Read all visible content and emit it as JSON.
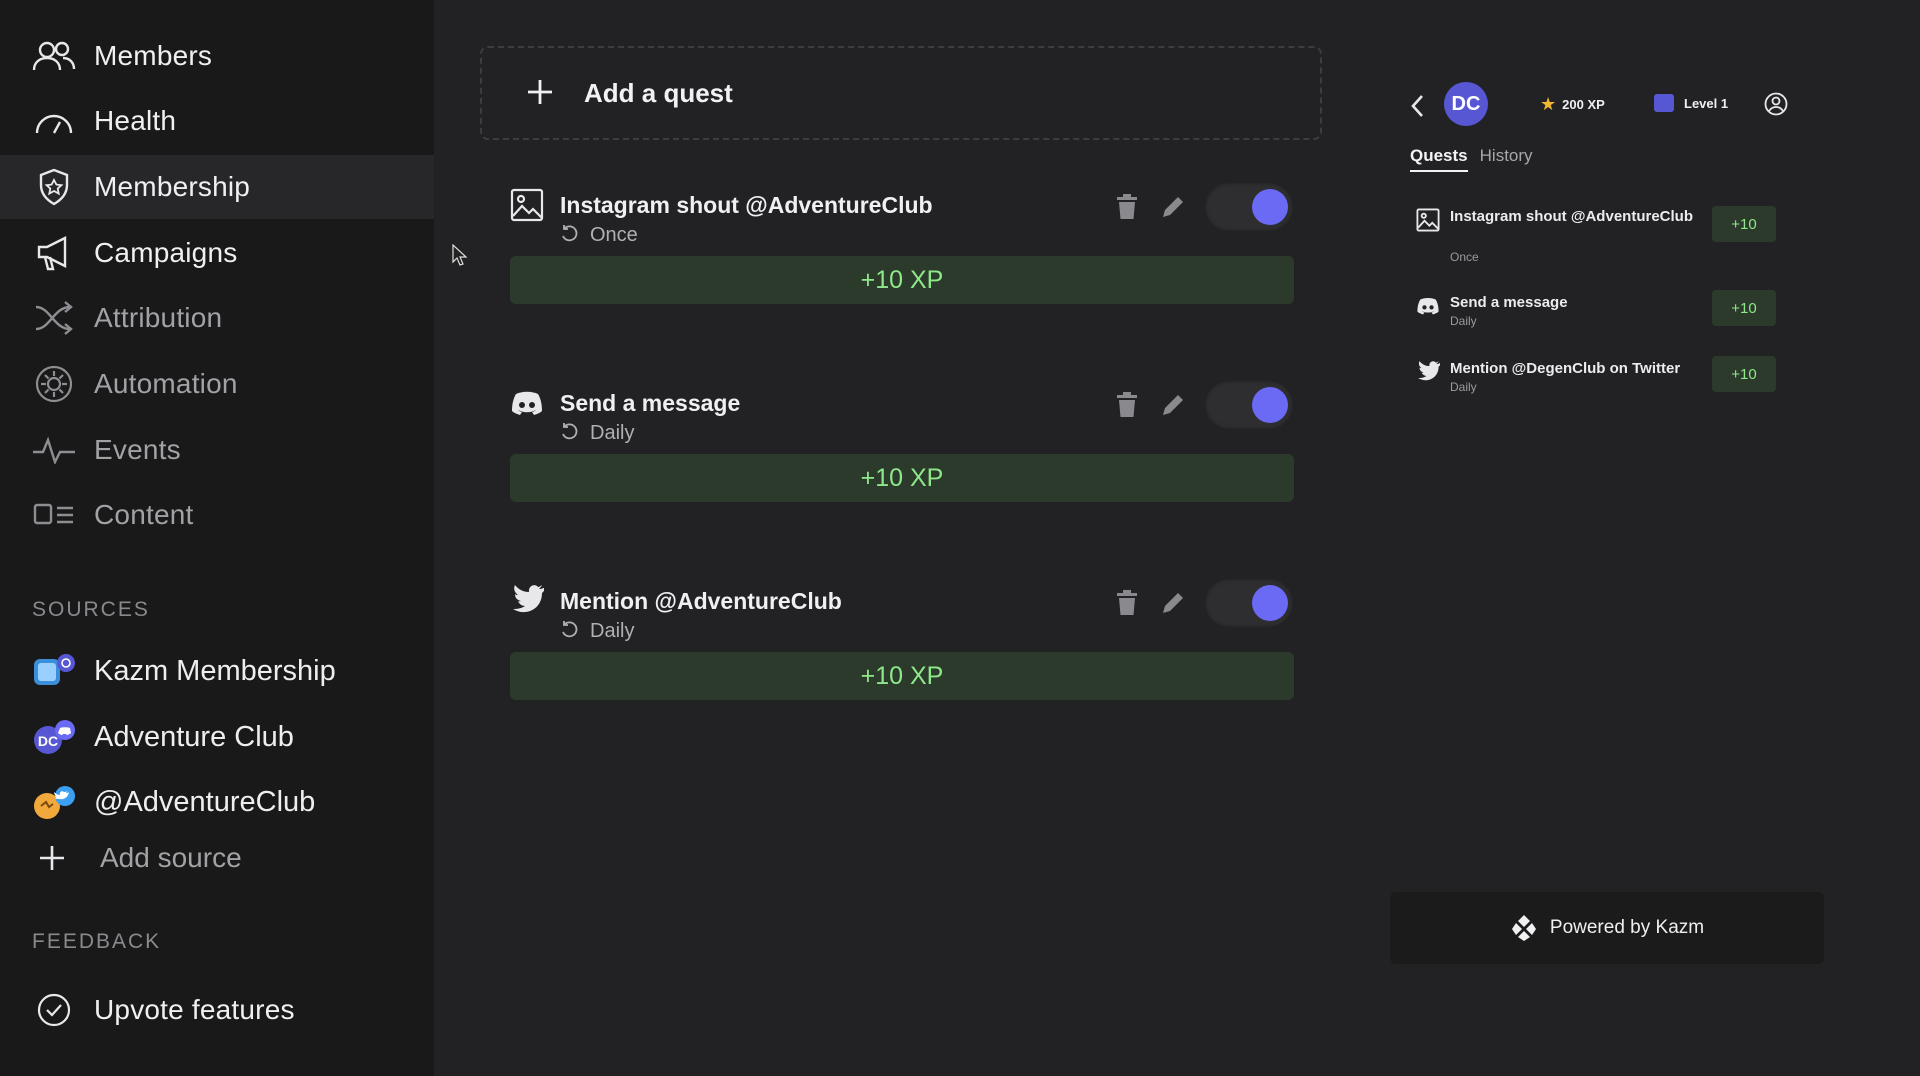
{
  "sidebar": {
    "nav": [
      {
        "label": "Members",
        "icon": "members-icon"
      },
      {
        "label": "Health",
        "icon": "gauge-icon"
      },
      {
        "label": "Membership",
        "icon": "shield-star-icon"
      },
      {
        "label": "Campaigns",
        "icon": "megaphone-icon"
      },
      {
        "label": "Attribution",
        "icon": "shuffle-icon"
      },
      {
        "label": "Automation",
        "icon": "gear-icon"
      },
      {
        "label": "Events",
        "icon": "pulse-icon"
      },
      {
        "label": "Content",
        "icon": "content-icon"
      }
    ],
    "sources_heading": "SOURCES",
    "sources": [
      {
        "label": "Kazm Membership"
      },
      {
        "label": "Adventure Club"
      },
      {
        "label": "@AdventureClub"
      }
    ],
    "add_source": "Add source",
    "feedback_heading": "FEEDBACK",
    "upvote": "Upvote features"
  },
  "main": {
    "add_quest": "Add a quest",
    "quests": [
      {
        "title": "Instagram shout @AdventureClub",
        "frequency": "Once",
        "xp": "+10 XP",
        "enabled": true,
        "icon": "image-icon"
      },
      {
        "title": "Send a message",
        "frequency": "Daily",
        "xp": "+10 XP",
        "enabled": true,
        "icon": "discord-icon"
      },
      {
        "title": "Mention @AdventureClub",
        "frequency": "Daily",
        "xp": "+10 XP",
        "enabled": true,
        "icon": "twitter-icon"
      }
    ]
  },
  "preview": {
    "logo": "DC",
    "xp": "200 XP",
    "level": "Level 1",
    "tabs": [
      "Quests",
      "History"
    ],
    "quests": [
      {
        "title": "Instagram shout @AdventureClub",
        "frequency": "Once",
        "xp": "+10"
      },
      {
        "title": "Send a message",
        "frequency": "Daily",
        "xp": "+10"
      },
      {
        "title": "Mention @DegenClub on Twitter",
        "frequency": "Daily",
        "xp": "+10"
      }
    ],
    "powered": "Powered by Kazm"
  },
  "colors": {
    "accent": "#6a6af5",
    "xp_green": "#8ee88a",
    "xp_bg": "#2c3a2c"
  }
}
